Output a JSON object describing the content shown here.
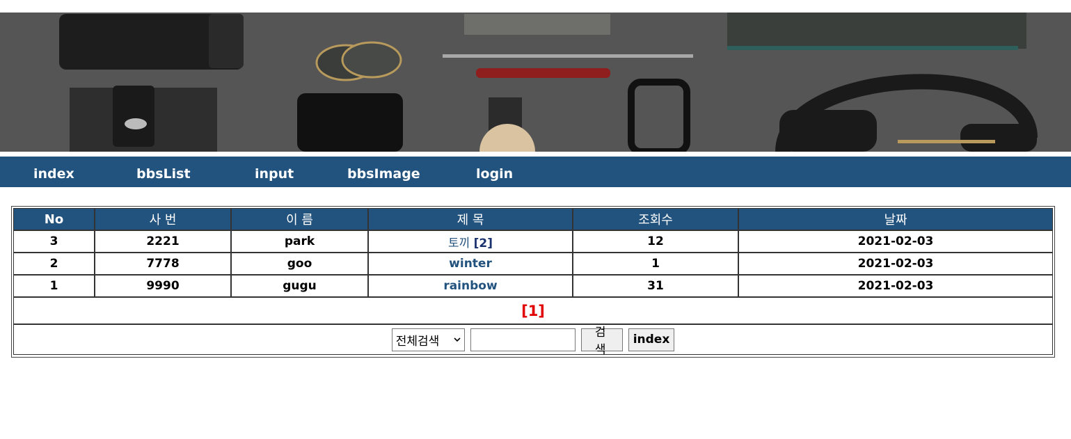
{
  "nav": {
    "items": [
      "index",
      "bbsList",
      "input",
      "bbsImage",
      "login"
    ]
  },
  "board": {
    "headers": [
      "No",
      "사 번",
      "이 름",
      "제 목",
      "조회수",
      "날짜"
    ],
    "rows": [
      {
        "no": "3",
        "emp_no": "2221",
        "name": "park",
        "subject": "토끼",
        "reply": "[2]",
        "views": "12",
        "date": "2021-02-03"
      },
      {
        "no": "2",
        "emp_no": "7778",
        "name": "goo",
        "subject": "winter",
        "reply": "",
        "views": "1",
        "date": "2021-02-03"
      },
      {
        "no": "1",
        "emp_no": "9990",
        "name": "gugu",
        "subject": "rainbow",
        "reply": "",
        "views": "31",
        "date": "2021-02-03"
      }
    ],
    "pager": "[1]"
  },
  "search": {
    "select_value": "전체검색",
    "input_value": "",
    "search_label": "검 색",
    "index_label": "index"
  },
  "colors": {
    "nav_bg": "#22527e",
    "pager": "#e00000"
  }
}
